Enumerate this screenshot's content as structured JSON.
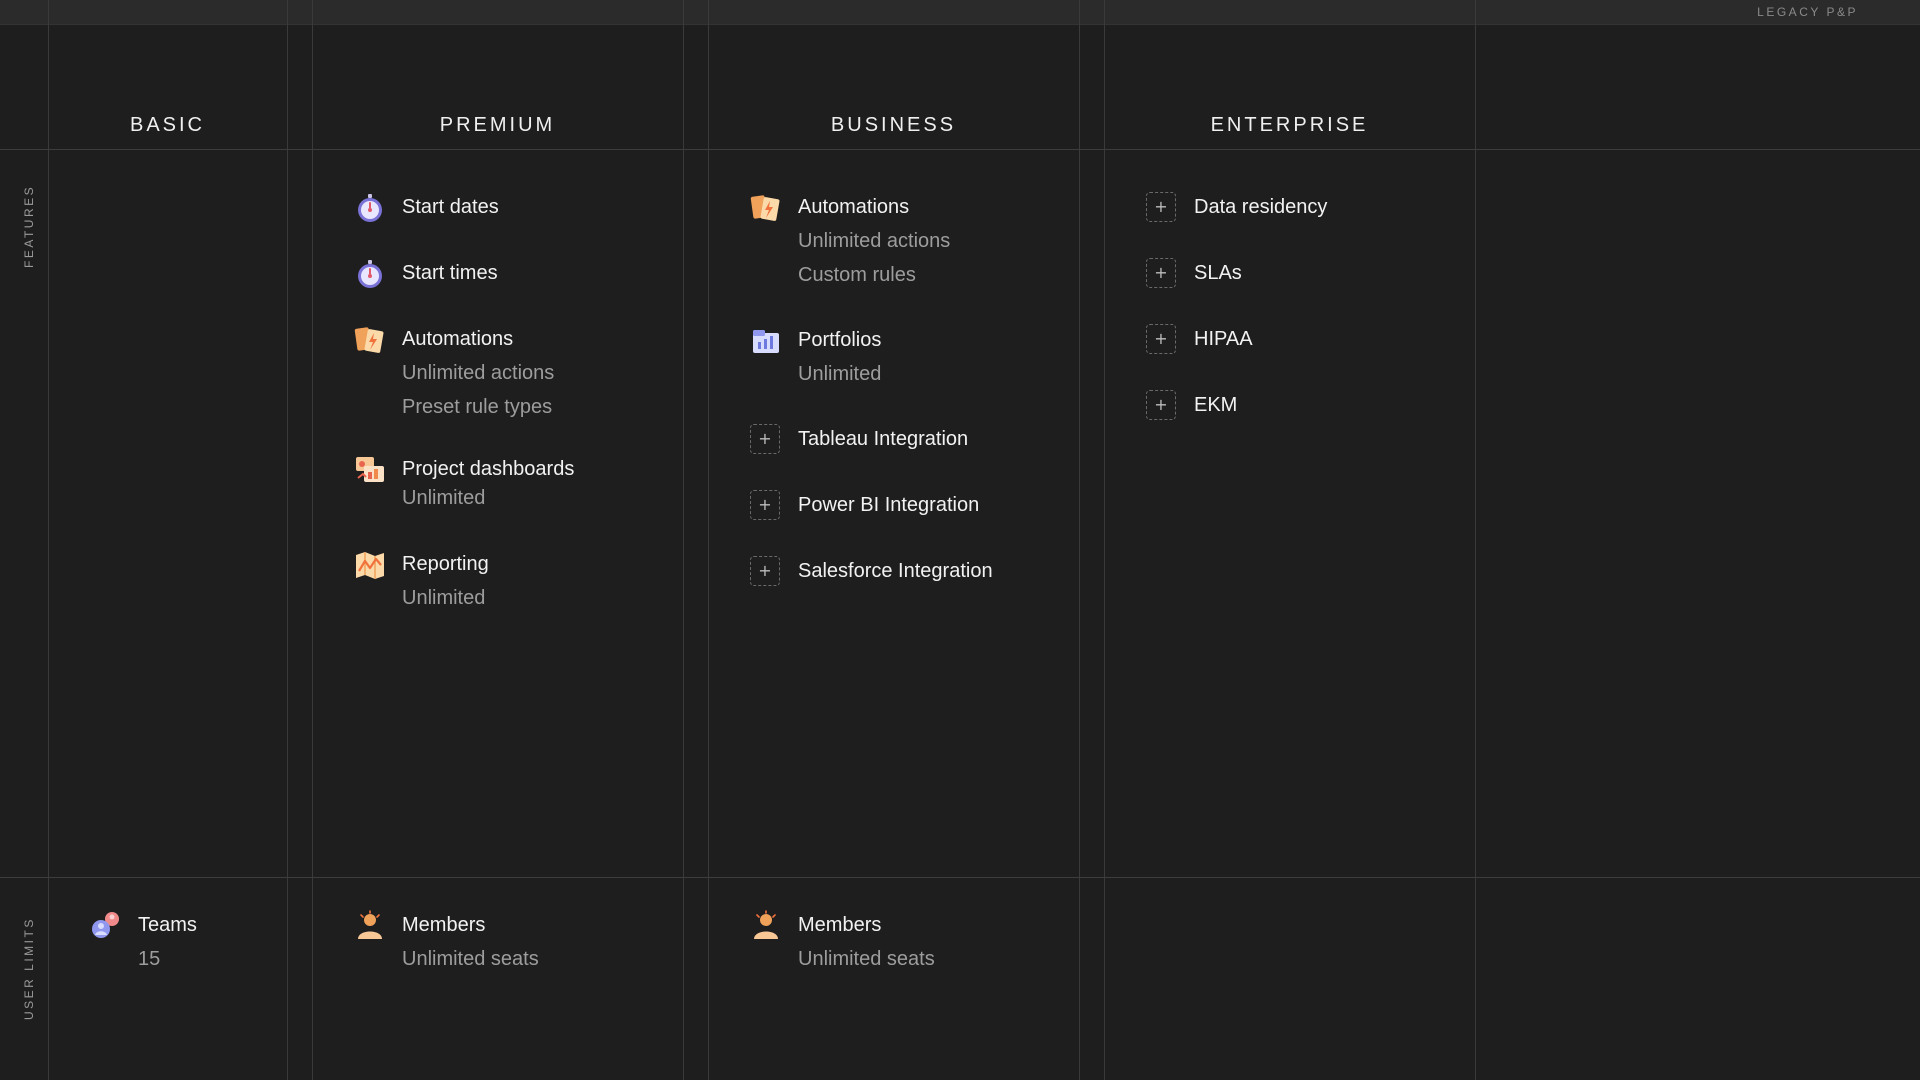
{
  "brand": "LEGACY P&P",
  "row_labels": {
    "features": "FEATURES",
    "user_limits": "USER LIMITS"
  },
  "columns": [
    {
      "name": "BASIC"
    },
    {
      "name": "PREMIUM"
    },
    {
      "name": "BUSINESS"
    },
    {
      "name": "ENTERPRISE"
    }
  ],
  "premium": {
    "features": [
      {
        "title": "Start dates",
        "icon": "stopwatch-icon"
      },
      {
        "title": "Start times",
        "icon": "stopwatch-icon"
      },
      {
        "title": "Automations",
        "icon": "lightning-cards-icon",
        "subs": [
          "Unlimited actions",
          "Preset rule types"
        ]
      },
      {
        "title": "Project dashboards",
        "icon": "dashboard-icon",
        "subs": [
          "Unlimited"
        ]
      },
      {
        "title": "Reporting",
        "icon": "map-icon",
        "subs": [
          "Unlimited"
        ]
      }
    ],
    "user_limit": {
      "title": "Members",
      "sub": "Unlimited seats",
      "icon": "person-icon"
    }
  },
  "business": {
    "features": [
      {
        "title": "Automations",
        "icon": "lightning-cards-icon",
        "subs": [
          "Unlimited actions",
          "Custom rules"
        ]
      },
      {
        "title": "Portfolios",
        "icon": "portfolio-icon",
        "subs": [
          "Unlimited"
        ]
      },
      {
        "title": "Tableau Integration",
        "icon": "plus-icon"
      },
      {
        "title": "Power BI Integration",
        "icon": "plus-icon"
      },
      {
        "title": "Salesforce Integration",
        "icon": "plus-icon"
      }
    ],
    "user_limit": {
      "title": "Members",
      "sub": "Unlimited seats",
      "icon": "person-icon"
    }
  },
  "enterprise": {
    "features": [
      {
        "title": "Data residency",
        "icon": "plus-icon"
      },
      {
        "title": "SLAs",
        "icon": "plus-icon"
      },
      {
        "title": "HIPAA",
        "icon": "plus-icon"
      },
      {
        "title": "EKM",
        "icon": "plus-icon"
      }
    ]
  },
  "basic": {
    "user_limit": {
      "title": "Teams",
      "sub": "15",
      "icon": "teams-icon"
    }
  },
  "colors": {
    "background": "#1e1e1e",
    "text": "#f2f2f2",
    "muted": "#9d9d9d",
    "line": "#3a3a3a"
  }
}
